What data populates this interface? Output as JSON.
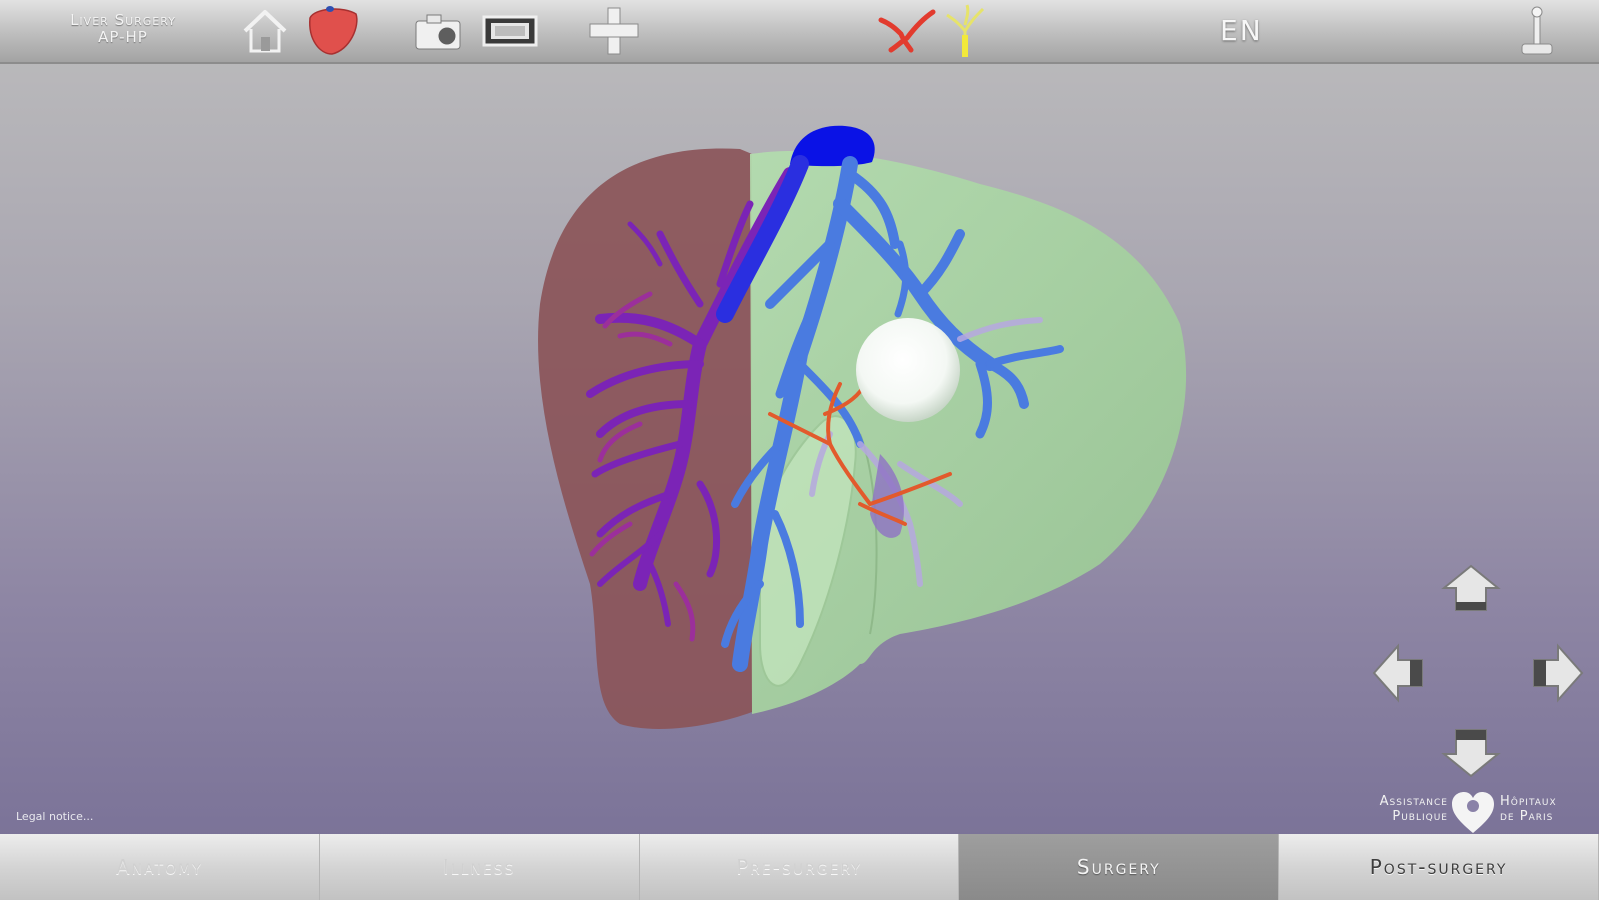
{
  "header": {
    "app_title_line1": "Liver Surgery",
    "app_title_line2": "AP-HP",
    "language": "EN",
    "icons": [
      "home-icon",
      "liver-model-icon",
      "camera-icon",
      "film-icon",
      "cross-icon",
      "arteries-icon",
      "biliary-tree-icon",
      "joystick-icon"
    ]
  },
  "footer": {
    "legal": "Legal notice..."
  },
  "logo": {
    "left_line1": "Assistance",
    "left_line2": "Publique",
    "right_line1": "Hôpitaux",
    "right_line2": "de Paris"
  },
  "tabs": [
    {
      "label": "Anatomy",
      "state": "disabled"
    },
    {
      "label": "Illness",
      "state": "disabled"
    },
    {
      "label": "Pre-surgery",
      "state": "disabled"
    },
    {
      "label": "Surgery",
      "state": "active"
    },
    {
      "label": "Post-surgery",
      "state": "enabled"
    }
  ],
  "navigation": [
    "arrow-up-icon",
    "arrow-left-icon",
    "arrow-right-icon",
    "arrow-down-icon"
  ],
  "colors": {
    "resected_segment": "#8a5257",
    "remaining_liver": "#a6d3a2",
    "portal_vein": "#4a76dc",
    "hepatic_vein": "#7a22b8",
    "vena_cava": "#0a14e8",
    "artery": "#e05a2a",
    "tumor": "#ffffff"
  }
}
